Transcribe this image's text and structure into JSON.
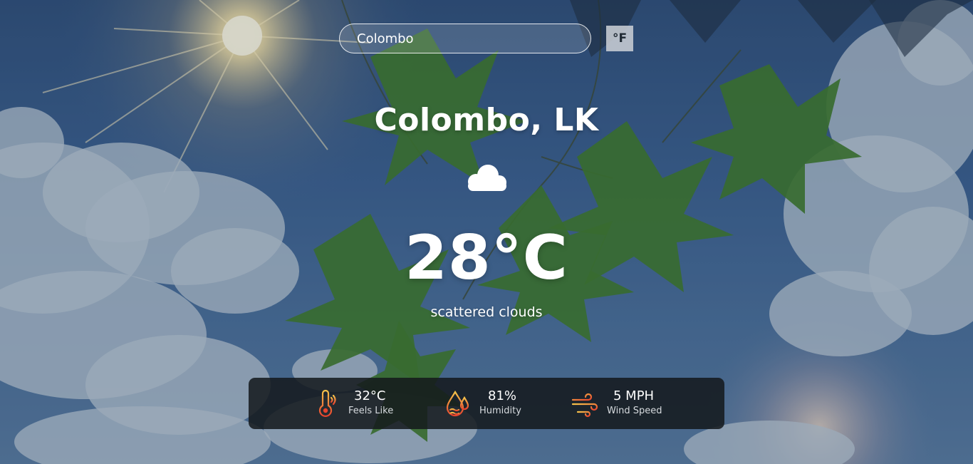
{
  "search": {
    "value": "Colombo"
  },
  "unit_toggle": {
    "label": "°F"
  },
  "location": {
    "title": "Colombo, LK"
  },
  "current": {
    "icon": "cloud-icon",
    "temperature": "28°C",
    "description": "scattered clouds"
  },
  "stats": [
    {
      "icon": "thermometer-icon",
      "value": "32°C",
      "label": "Feels Like"
    },
    {
      "icon": "humidity-drop-icon",
      "value": "81%",
      "label": "Humidity"
    },
    {
      "icon": "wind-icon",
      "value": "5 MPH",
      "label": "Wind Speed"
    }
  ],
  "colors": {
    "icon_gradient_start": "#f6c34a",
    "icon_gradient_end": "#e8432e",
    "stats_bar": "#14181c"
  }
}
